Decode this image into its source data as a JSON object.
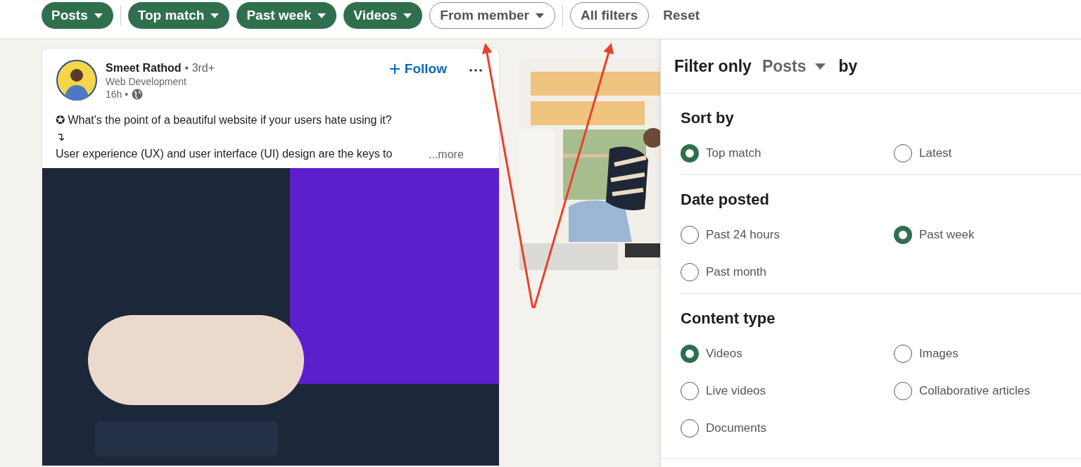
{
  "filter_bar": {
    "chips": [
      {
        "label": "Posts",
        "selected": true,
        "dropdown": true,
        "divider_after": true
      },
      {
        "label": "Top match",
        "selected": true,
        "dropdown": true,
        "divider_after": false
      },
      {
        "label": "Past week",
        "selected": true,
        "dropdown": true,
        "divider_after": false
      },
      {
        "label": "Videos",
        "selected": true,
        "dropdown": true,
        "divider_after": false
      },
      {
        "label": "From member",
        "selected": false,
        "dropdown": true,
        "divider_after": true
      },
      {
        "label": "All filters",
        "selected": false,
        "dropdown": false,
        "divider_after": false
      }
    ],
    "reset": "Reset"
  },
  "post": {
    "author": "Smeet Rathod",
    "degree": "• 3rd+",
    "headline": "Web Development",
    "time": "16h •",
    "follow": "Follow",
    "lines": [
      "✪ What's the point of a beautiful website if your users hate using it?",
      "↴",
      "User experience (UX) and user interface (UI) design are the keys to"
    ],
    "more": "...more"
  },
  "filter_panel": {
    "title": "Filter only",
    "type": "Posts",
    "by": "by",
    "sections": [
      {
        "heading": "Sort by",
        "options": [
          {
            "label": "Top match",
            "selected": true
          },
          {
            "label": "Latest",
            "selected": false
          }
        ]
      },
      {
        "heading": "Date posted",
        "options": [
          {
            "label": "Past 24 hours",
            "selected": false
          },
          {
            "label": "Past week",
            "selected": true
          },
          {
            "label": "Past month",
            "selected": false
          }
        ]
      },
      {
        "heading": "Content type",
        "options": [
          {
            "label": "Videos",
            "selected": true
          },
          {
            "label": "Images",
            "selected": false
          },
          {
            "label": "Live videos",
            "selected": false
          },
          {
            "label": "Collaborative articles",
            "selected": false
          },
          {
            "label": "Documents",
            "selected": false
          }
        ]
      }
    ]
  }
}
